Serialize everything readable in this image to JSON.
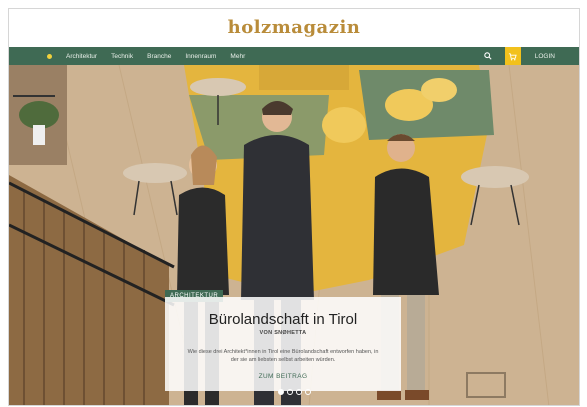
{
  "logo": "holzmagazin",
  "nav": {
    "items": [
      "Architektur",
      "Technik",
      "Branche",
      "Innenraum",
      "Mehr"
    ],
    "login": "LOGIN"
  },
  "hero": {
    "tag": "ARCHITEKTUR",
    "title": "Bürolandschaft in Tirol",
    "subtitle": "VON SNØHETTA",
    "text": "Wie diese drei Architekt*innen in Tirol eine Bürolandschaft entworfen haben, in der sie am liebsten selbst arbeiten würden.",
    "cta": "ZUM BEITRAG"
  },
  "carousel": {
    "count": 4,
    "active": 1
  },
  "colors": {
    "nav": "#3f6a54",
    "cart": "#f2c11c",
    "logo": "#b98c3a"
  },
  "icons": [
    "search-icon",
    "cart-icon"
  ]
}
